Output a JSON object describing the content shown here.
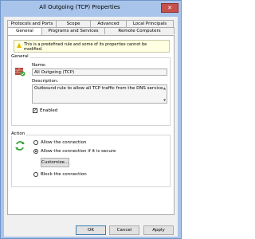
{
  "window": {
    "title": "All Outgoing (TCP) Properties",
    "close_label": "✕"
  },
  "tabs_row1": [
    {
      "label": "Protocols and Ports"
    },
    {
      "label": "Scope"
    },
    {
      "label": "Advanced"
    },
    {
      "label": "Local Principals"
    }
  ],
  "tabs_row2": [
    {
      "label": "General",
      "active": true
    },
    {
      "label": "Programs and Services"
    },
    {
      "label": "Remote Computers"
    }
  ],
  "notice": {
    "text": "This is a predefined rule and some of its properties cannot be modified."
  },
  "general": {
    "group_label": "General",
    "name_label": "Name:",
    "name_value": "All Outgoing (TCP)",
    "description_label": "Description:",
    "description_value": "Outbound rule to allow all TCP traffic from the DNS service.",
    "enabled_label": "Enabled",
    "enabled_checked": true
  },
  "action": {
    "group_label": "Action",
    "options": [
      {
        "label": "Allow the connection",
        "selected": false
      },
      {
        "label": "Allow the connection if it is secure",
        "selected": true
      },
      {
        "label": "Block the connection",
        "selected": false
      }
    ],
    "customize_label": "Customize..."
  },
  "footer": {
    "ok_label": "OK",
    "cancel_label": "Cancel",
    "apply_label": "Apply"
  }
}
